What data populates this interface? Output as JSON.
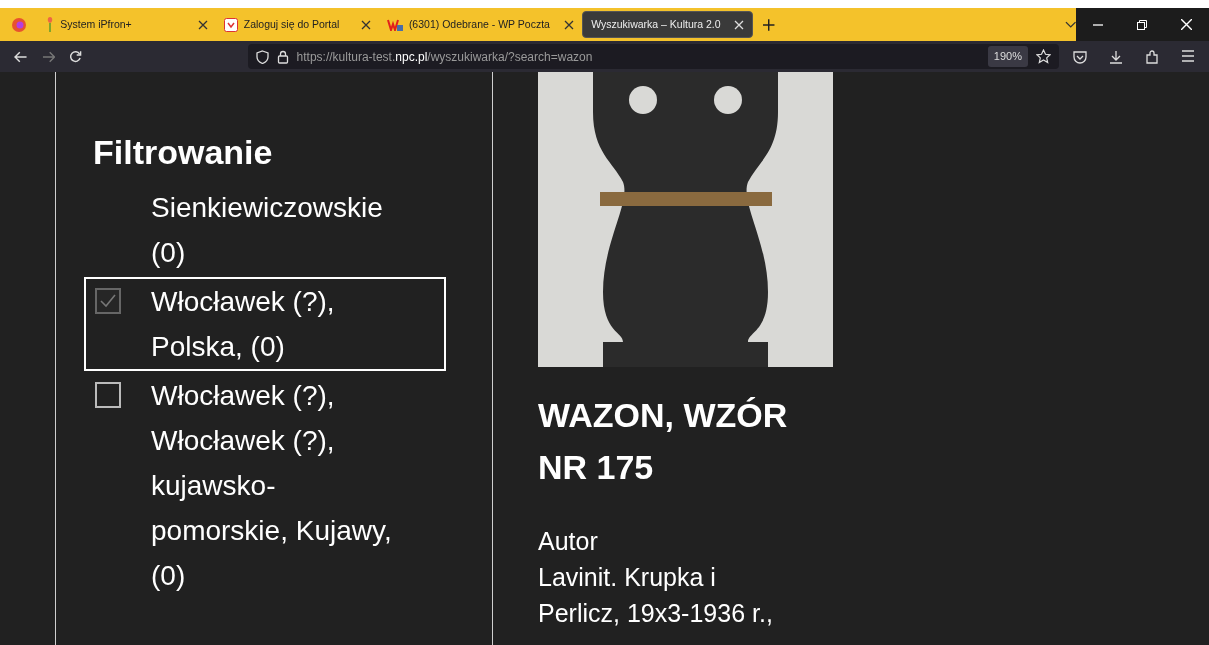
{
  "browser": {
    "tabs": [
      {
        "title": "System iPfron+",
        "selected": false
      },
      {
        "title": "Zaloguj się do Portal",
        "selected": false
      },
      {
        "title": "(6301) Odebrane - WP Poczta",
        "selected": false
      },
      {
        "title": "Wyszukiwarka – Kultura 2.0",
        "selected": true
      }
    ],
    "url": {
      "prefix": "https://kultura-test.",
      "domain": "npc.pl",
      "path": "/wyszukiwarka/?search=wazon"
    },
    "zoom": "190%"
  },
  "filters": {
    "heading": "Filtrowanie",
    "items": [
      {
        "kind": "continued",
        "label": "Sienkiewiczowskie (0)"
      },
      {
        "kind": "option",
        "label": "Włocławek (?), Polska, (0)",
        "checked": true,
        "focused": true
      },
      {
        "kind": "option",
        "label": "Włocławek (?), Włocławek (?), kujawsko-pomorskie, Kujawy, (0)",
        "checked": false,
        "focused": false
      }
    ]
  },
  "result": {
    "title": "WAZON, WZÓR NR 175",
    "fields": [
      {
        "label": "Autor",
        "value": "Lavinit. Krupka i Perlicz, 19x3-1936 r.,"
      }
    ]
  }
}
